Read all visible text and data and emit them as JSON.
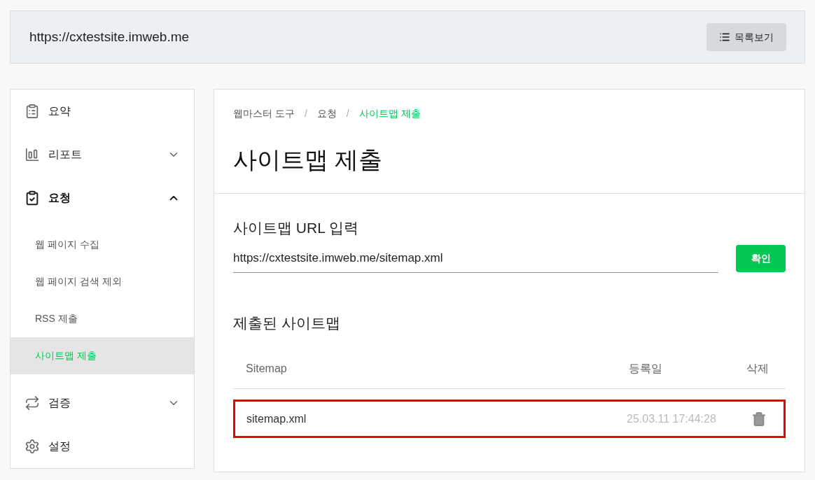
{
  "header": {
    "url": "https://cxtestsite.imweb.me",
    "list_button": "목록보기"
  },
  "sidebar": {
    "items": [
      {
        "label": "요약",
        "kind": "link",
        "selected": false
      },
      {
        "label": "리포트",
        "kind": "group",
        "expanded": false,
        "selected": false
      },
      {
        "label": "요청",
        "kind": "group",
        "expanded": true,
        "selected": true,
        "children": [
          {
            "label": "웹 페이지 수집",
            "selected": false
          },
          {
            "label": "웹 페이지 검색 제외",
            "selected": false
          },
          {
            "label": "RSS 제출",
            "selected": false
          },
          {
            "label": "사이트맵 제출",
            "selected": true
          }
        ]
      },
      {
        "label": "검증",
        "kind": "group",
        "expanded": false,
        "selected": false
      },
      {
        "label": "설정",
        "kind": "link",
        "selected": false
      }
    ]
  },
  "breadcrumb": {
    "separators": [
      "/",
      "/"
    ],
    "items": [
      {
        "label": "웹마스터 도구",
        "current": false
      },
      {
        "label": "요청",
        "current": false
      },
      {
        "label": "사이트맵 제출",
        "current": true
      }
    ]
  },
  "page_title": "사이트맵 제출",
  "url_section": {
    "title": "사이트맵 URL 입력",
    "value": "https://cxtestsite.imweb.me/sitemap.xml",
    "button": "확인"
  },
  "submitted": {
    "title": "제출된 사이트맵",
    "columns": [
      "Sitemap",
      "등록일",
      "삭제"
    ],
    "rows": [
      {
        "sitemap": "sitemap.xml",
        "date": "25.03.11 17:44:28",
        "highlighted": true
      }
    ]
  }
}
